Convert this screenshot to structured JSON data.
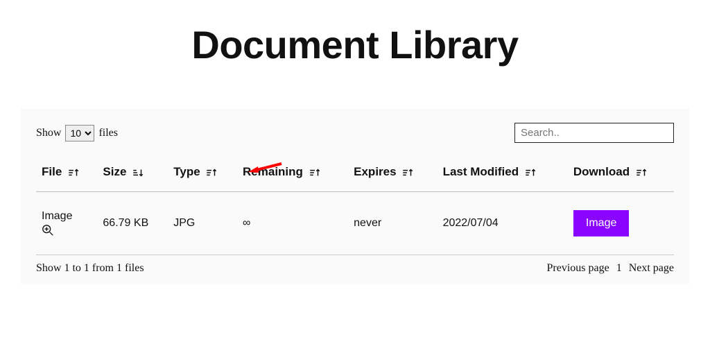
{
  "title": "Document Library",
  "controls": {
    "show_label": "Show",
    "files_label": "files",
    "page_size": "10",
    "search_placeholder": "Search.."
  },
  "columns": {
    "file": "File",
    "size": "Size",
    "type": "Type",
    "remaining": "Remaining",
    "expires": "Expires",
    "last_modified": "Last Modified",
    "download": "Download"
  },
  "rows": [
    {
      "file": "Image",
      "size": "66.79 KB",
      "type": "JPG",
      "remaining": "∞",
      "expires": "never",
      "last_modified": "2022/07/04",
      "download_label": "Image"
    }
  ],
  "footer": {
    "summary": "Show 1 to 1 from 1 files",
    "prev": "Previous page",
    "page": "1",
    "next": "Next page"
  },
  "annotation": {
    "arrow_color": "#ff0000"
  }
}
